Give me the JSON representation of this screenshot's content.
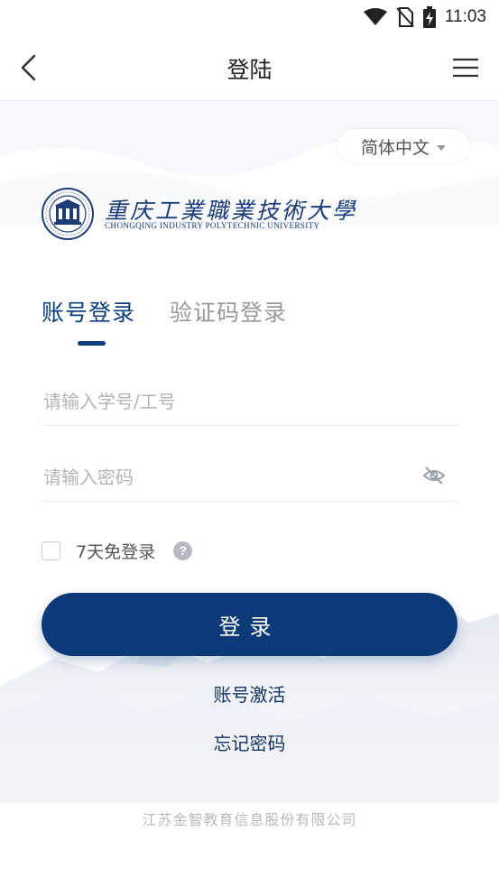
{
  "status_bar": {
    "time": "11:03"
  },
  "nav": {
    "title": "登陆"
  },
  "language": {
    "selected": "简体中文"
  },
  "logo": {
    "name_cn": "重庆工業職業技術大學",
    "name_en": "CHONGQING INDUSTRY POLYTECHNIC UNIVERSITY"
  },
  "tabs": [
    {
      "label": "账号登录",
      "active": true
    },
    {
      "label": "验证码登录",
      "active": false
    }
  ],
  "form": {
    "username_placeholder": "请输入学号/工号",
    "username_value": "",
    "password_placeholder": "请输入密码",
    "password_value": "",
    "remember_label": "7天免登录",
    "remember_checked": false,
    "help_symbol": "?"
  },
  "actions": {
    "login_label": "登录",
    "activate_label": "账号激活",
    "forgot_label": "忘记密码"
  },
  "footer": {
    "company": "江苏金智教育信息股份有限公司"
  },
  "colors": {
    "primary": "#0c3a78",
    "tab_active": "#0c3d7c",
    "logo": "#1d3c78"
  },
  "icons": [
    "wifi-icon",
    "no-sim-icon",
    "battery-charging-icon",
    "back-arrow-icon",
    "menu-icon",
    "chevron-down-icon",
    "eye-off-icon",
    "help-icon"
  ]
}
